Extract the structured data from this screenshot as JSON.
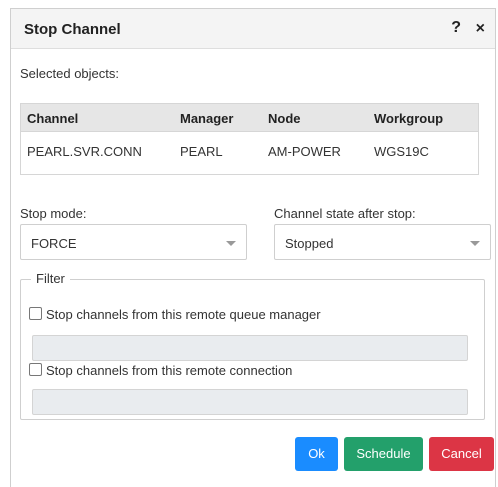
{
  "dialog": {
    "title": "Stop Channel",
    "help_icon": "?",
    "close_icon": "×"
  },
  "selected_objects": {
    "label": "Selected objects:",
    "columns": [
      "Channel",
      "Manager",
      "Node",
      "Workgroup"
    ],
    "rows": [
      [
        "PEARL.SVR.CONN",
        "PEARL",
        "AM-POWER",
        "WGS19C"
      ]
    ]
  },
  "stop_mode": {
    "label": "Stop mode:",
    "value": "FORCE"
  },
  "channel_state": {
    "label": "Channel state after stop:",
    "value": "Stopped"
  },
  "filter": {
    "legend": "Filter",
    "remote_qmgr_label": "Stop channels from this remote queue manager",
    "remote_qmgr_checked": false,
    "remote_qmgr_value": "",
    "remote_conn_label": "Stop channels from this remote connection",
    "remote_conn_checked": false,
    "remote_conn_value": ""
  },
  "buttons": {
    "ok": "Ok",
    "schedule": "Schedule",
    "cancel": "Cancel"
  },
  "colors": {
    "ok": "#1a8cff",
    "schedule": "#23a06b",
    "cancel": "#dc3545",
    "header_bg": "#e6e6e6"
  }
}
